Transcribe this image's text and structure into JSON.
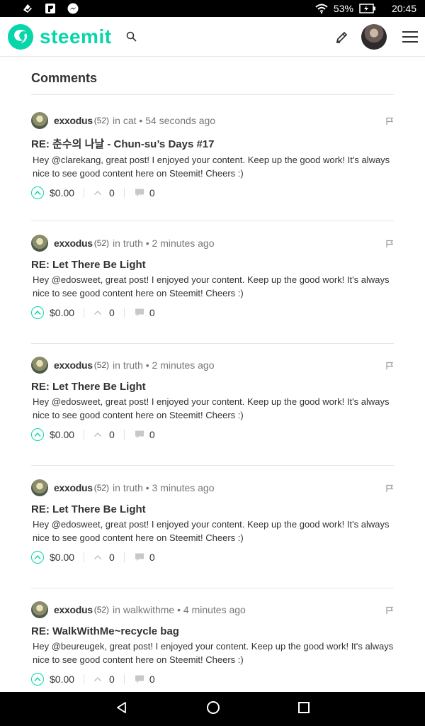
{
  "status_bar": {
    "battery": "53%",
    "time": "20:45"
  },
  "app": {
    "logo_text": "steemit"
  },
  "section": {
    "title": "Comments"
  },
  "comments": [
    {
      "author": "exxodus",
      "reputation": "(52)",
      "in_label": "in",
      "category": "cat",
      "bullet": "•",
      "time_ago": "54 seconds ago",
      "title": "RE: 춘수의 나날 - Chun-su’s Days #17",
      "body": "Hey @clarekang, great post! I enjoyed your content. Keep up the good work! It's always nice to see good content here on Steemit! Cheers :)",
      "payout": "$0.00",
      "votes": "0",
      "replies": "0"
    },
    {
      "author": "exxodus",
      "reputation": "(52)",
      "in_label": "in",
      "category": "truth",
      "bullet": "•",
      "time_ago": "2 minutes ago",
      "title": "RE: Let There Be Light",
      "body": "Hey @edosweet, great post! I enjoyed your content. Keep up the good work! It's always nice to see good content here on Steemit! Cheers :)",
      "payout": "$0.00",
      "votes": "0",
      "replies": "0"
    },
    {
      "author": "exxodus",
      "reputation": "(52)",
      "in_label": "in",
      "category": "truth",
      "bullet": "•",
      "time_ago": "2 minutes ago",
      "title": "RE: Let There Be Light",
      "body": "Hey @edosweet, great post! I enjoyed your content. Keep up the good work! It's always nice to see good content here on Steemit! Cheers :)",
      "payout": "$0.00",
      "votes": "0",
      "replies": "0"
    },
    {
      "author": "exxodus",
      "reputation": "(52)",
      "in_label": "in",
      "category": "truth",
      "bullet": "•",
      "time_ago": "3 minutes ago",
      "title": "RE: Let There Be Light",
      "body": "Hey @edosweet, great post! I enjoyed your content. Keep up the good work! It's always nice to see good content here on Steemit! Cheers :)",
      "payout": "$0.00",
      "votes": "0",
      "replies": "0"
    },
    {
      "author": "exxodus",
      "reputation": "(52)",
      "in_label": "in",
      "category": "walkwithme",
      "bullet": "•",
      "time_ago": "4 minutes ago",
      "title": "RE: WalkWithMe~recycle bag",
      "body": "Hey @beureugek, great post! I enjoyed your content. Keep up the good work! It's always nice to see good content here on Steemit! Cheers :)",
      "payout": "$0.00",
      "votes": "0",
      "replies": "0"
    }
  ],
  "colors": {
    "accent": "#06d6a9",
    "text": "#333333",
    "muted": "#777777"
  },
  "icons": [
    "notification-icon",
    "flipboard-icon",
    "messenger-icon",
    "wifi-icon",
    "battery-icon",
    "search-icon",
    "pencil-icon",
    "flag-icon",
    "upvote-icon",
    "votes-chevron-icon",
    "reply-icon",
    "back-icon",
    "home-icon",
    "recents-icon"
  ]
}
